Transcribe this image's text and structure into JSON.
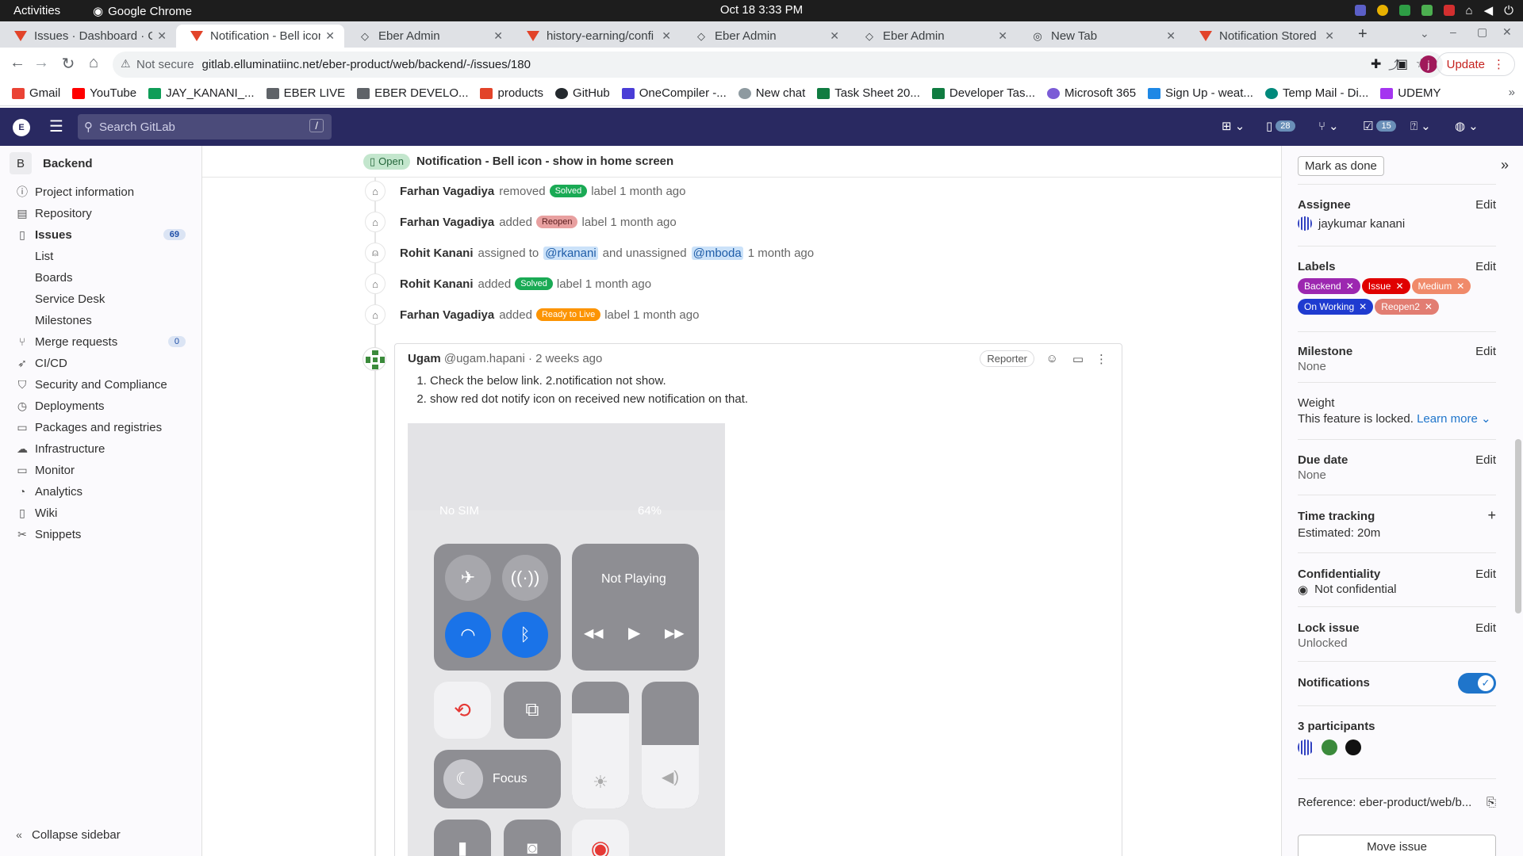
{
  "os": {
    "activities": "Activities",
    "app": "Google Chrome",
    "clock": "Oct 18  3:33 PM"
  },
  "tabs": [
    {
      "title": "Issues · Dashboard · Gi",
      "icon": "gitlab-icon"
    },
    {
      "title": "Notification - Bell icon",
      "icon": "gitlab-icon",
      "active": true
    },
    {
      "title": "Eber Admin",
      "icon": "eber-icon"
    },
    {
      "title": "history-earning/confi",
      "icon": "gitlab-icon"
    },
    {
      "title": "Eber Admin",
      "icon": "eber-icon"
    },
    {
      "title": "Eber Admin",
      "icon": "eber-icon"
    },
    {
      "title": "New Tab",
      "icon": "chrome-icon"
    },
    {
      "title": "Notification Stored · E",
      "icon": "gitlab-icon"
    }
  ],
  "omnibox": {
    "security": "Not secure",
    "url": "gitlab.elluminatiinc.net/eber-product/web/backend/-/issues/180",
    "update": "Update"
  },
  "bookmarks": [
    "Gmail",
    "YouTube",
    "JAY_KANANI_...",
    "EBER LIVE",
    "EBER DEVELO...",
    "products",
    "GitHub",
    "OneCompiler -...",
    "New chat",
    "Task Sheet 20...",
    "Developer Tas...",
    "Microsoft 365",
    "Sign Up - weat...",
    "Temp Mail - Di...",
    "UDEMY"
  ],
  "header": {
    "search_placeholder": "Search GitLab",
    "slash": "/",
    "mr_count": "28",
    "todo_count": "15"
  },
  "sidebar": {
    "project": "Backend",
    "project_initial": "B",
    "items": [
      {
        "label": "Project information",
        "icon": "info-icon"
      },
      {
        "label": "Repository",
        "icon": "doc-icon"
      },
      {
        "label": "Issues",
        "icon": "issues-icon",
        "badge": "69"
      },
      {
        "label": "List"
      },
      {
        "label": "Boards"
      },
      {
        "label": "Service Desk"
      },
      {
        "label": "Milestones"
      },
      {
        "label": "Merge requests",
        "icon": "merge-icon",
        "badge": "0"
      },
      {
        "label": "CI/CD",
        "icon": "rocket-icon"
      },
      {
        "label": "Security and Compliance",
        "icon": "shield-icon"
      },
      {
        "label": "Deployments",
        "icon": "deploy-icon"
      },
      {
        "label": "Packages and registries",
        "icon": "package-icon"
      },
      {
        "label": "Infrastructure",
        "icon": "cloud-icon"
      },
      {
        "label": "Monitor",
        "icon": "monitor-icon"
      },
      {
        "label": "Analytics",
        "icon": "chart-icon"
      },
      {
        "label": "Wiki",
        "icon": "book-icon"
      },
      {
        "label": "Snippets",
        "icon": "scissors-icon"
      }
    ],
    "collapse": "Collapse sidebar"
  },
  "issue": {
    "status": "Open",
    "title": "Notification - Bell icon - show in home screen"
  },
  "notes": [
    {
      "author": "Farhan Vagadiya",
      "action": "removed",
      "label": "Solved",
      "label_color": "#1aaa55",
      "rest": "label 1 month ago"
    },
    {
      "author": "Farhan Vagadiya",
      "action": "added",
      "label": "Reopen",
      "label_color": "#e8a0a0",
      "rest": "label 1 month ago"
    },
    {
      "author": "Rohit Kanani",
      "action": "assigned to",
      "m1": "@rkanani",
      "mid": "and unassigned",
      "m2": "@mboda",
      "rest": "1 month ago"
    },
    {
      "author": "Rohit Kanani",
      "action": "added",
      "label": "Solved",
      "label_color": "#1aaa55",
      "rest": "label 1 month ago"
    },
    {
      "author": "Farhan Vagadiya",
      "action": "added",
      "label": "Ready to Live",
      "label_color": "#fc9403",
      "rest": "label 1 month ago"
    }
  ],
  "comment": {
    "author": "Ugam",
    "handle": "@ugam.hapani · 2 weeks ago",
    "role": "Reporter",
    "items": [
      "Check the below link. 2.notification not show.",
      "show red dot notify icon on received new notification on that."
    ],
    "phone": {
      "carrier": "No SIM",
      "battery": "64%",
      "now_playing": "Not Playing",
      "focus": "Focus"
    }
  },
  "right": {
    "mark_done": "Mark as done",
    "assignee": {
      "h": "Assignee",
      "edit": "Edit",
      "name": "jaykumar kanani"
    },
    "labels": {
      "h": "Labels",
      "edit": "Edit",
      "items": [
        {
          "t": "Backend",
          "c": "#9c27b0"
        },
        {
          "t": "Issue",
          "c": "#e00000"
        },
        {
          "t": "Medium",
          "c": "#f08a6a"
        },
        {
          "t": "On Working",
          "c": "#1f3bd0"
        },
        {
          "t": "Reopen2",
          "c": "#e27d72"
        }
      ]
    },
    "milestone": {
      "h": "Milestone",
      "edit": "Edit",
      "v": "None"
    },
    "weight": {
      "h": "Weight",
      "v": "This feature is locked.",
      "link": "Learn more"
    },
    "due": {
      "h": "Due date",
      "edit": "Edit",
      "v": "None"
    },
    "time": {
      "h": "Time tracking",
      "v": "Estimated: 20m"
    },
    "conf": {
      "h": "Confidentiality",
      "edit": "Edit",
      "v": "Not confidential"
    },
    "lock": {
      "h": "Lock issue",
      "edit": "Edit",
      "v": "Unlocked"
    },
    "notif": {
      "h": "Notifications"
    },
    "participants": {
      "h": "3 participants"
    },
    "reference": "Reference: eber-product/web/b...",
    "move": "Move issue"
  }
}
